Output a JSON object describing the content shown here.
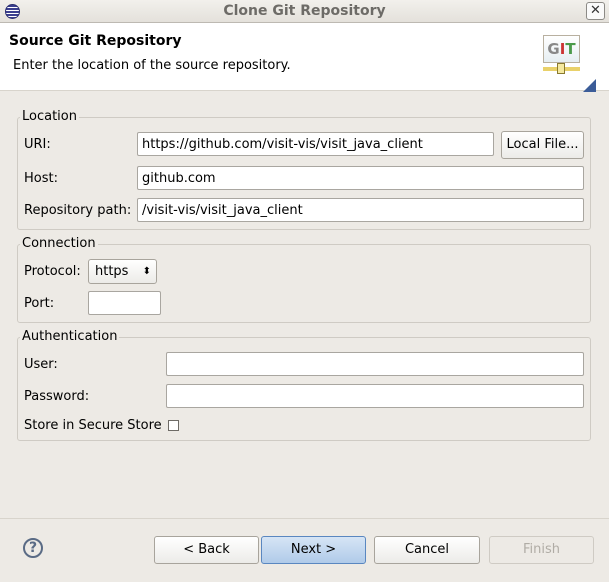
{
  "window": {
    "title": "Clone Git Repository"
  },
  "header": {
    "title": "Source Git Repository",
    "description": "Enter the location of the source repository.",
    "logo_text": "GIT"
  },
  "location": {
    "group_label": "Location",
    "uri_label": "URI:",
    "uri_value": "https://github.com/visit-vis/visit_java_client",
    "local_file_button": "Local File...",
    "host_label": "Host:",
    "host_value": "github.com",
    "path_label": "Repository path:",
    "path_value": "/visit-vis/visit_java_client"
  },
  "connection": {
    "group_label": "Connection",
    "protocol_label": "Protocol:",
    "protocol_value": "https",
    "port_label": "Port:",
    "port_value": ""
  },
  "authentication": {
    "group_label": "Authentication",
    "user_label": "User:",
    "user_value": "",
    "password_label": "Password:",
    "password_value": "",
    "store_label": "Store in Secure Store",
    "store_checked": false
  },
  "buttons": {
    "help": "?",
    "back": "< Back",
    "next": "Next >",
    "cancel": "Cancel",
    "finish": "Finish"
  }
}
